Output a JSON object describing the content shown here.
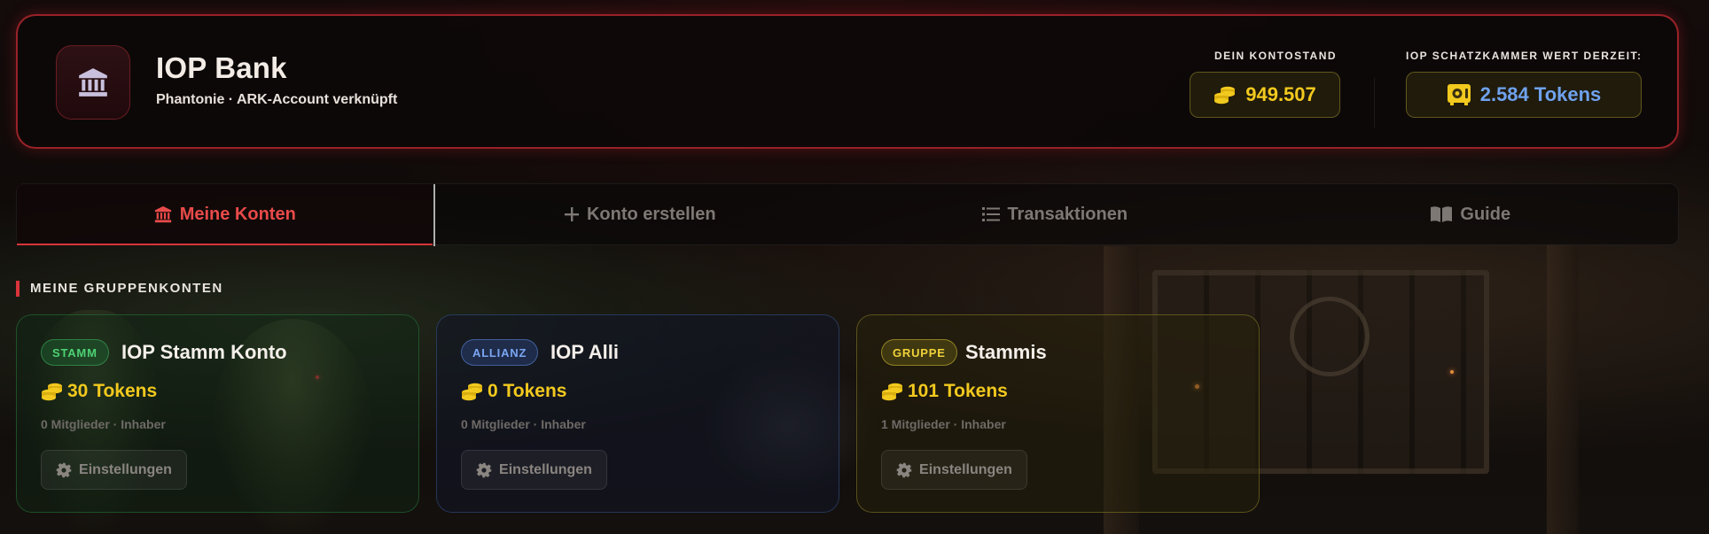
{
  "header": {
    "app_title": "IOP Bank",
    "subtitle": "Phantonie · ARK-Account verknüpft",
    "logo_icon": "bank-icon",
    "balance": {
      "label": "DEIN KONTOSTAND",
      "value": "949.507",
      "icon": "coins-icon"
    },
    "treasury": {
      "label": "IOP SCHATZKAMMER WERT DERZEIT:",
      "value": "2.584 Tokens",
      "icon": "vault-icon"
    }
  },
  "tabs": [
    {
      "label": "Meine Konten",
      "icon": "bank-icon",
      "active": true
    },
    {
      "label": "Konto erstellen",
      "icon": "plus-icon",
      "active": false
    },
    {
      "label": "Transaktionen",
      "icon": "list-icon",
      "active": false
    },
    {
      "label": "Guide",
      "icon": "book-icon",
      "active": false
    }
  ],
  "section": {
    "title": "MEINE GRUPPENKONTEN"
  },
  "accounts": [
    {
      "badge": "STAMM",
      "name": "IOP Stamm Konto",
      "tokens": "30 Tokens",
      "meta": "0 Mitglieder · Inhaber",
      "settings_label": "Einstellungen"
    },
    {
      "badge": "ALLIANZ",
      "name": "IOP Alli",
      "tokens": "0 Tokens",
      "meta": "0 Mitglieder · Inhaber",
      "settings_label": "Einstellungen"
    },
    {
      "badge": "GRUPPE",
      "name": "Stammis",
      "tokens": "101 Tokens",
      "meta": "1 Mitglieder · Inhaber",
      "settings_label": "Einstellungen"
    }
  ],
  "colors": {
    "accent_red": "#d8343a",
    "token_gold": "#f2c91e",
    "treasury_blue": "#6fa2ee",
    "stamm_green": "#4fd174",
    "allianz_blue": "#7aa6f2",
    "gruppe_yellow": "#f0d23a"
  }
}
